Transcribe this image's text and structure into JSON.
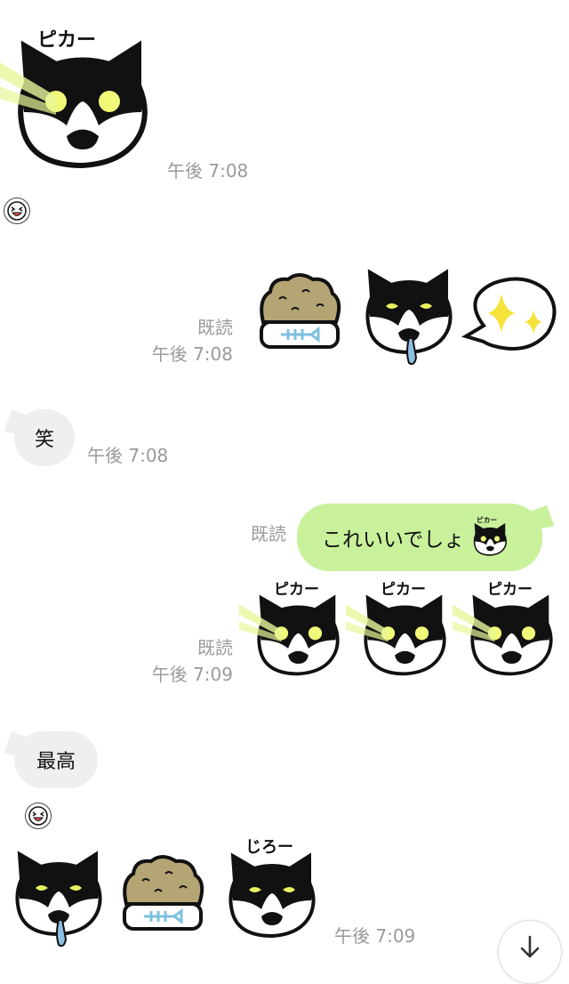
{
  "messages": [
    {
      "side": "in",
      "kind": "sticker",
      "sticker": "cat-pika",
      "sticker_text": "ピカー",
      "time": "午後 7:08"
    },
    {
      "side": "out",
      "kind": "emoji-set",
      "stickers": [
        "cat-food-bowl",
        "cat-drool",
        "sparkle-bubble"
      ],
      "read": "既読",
      "time": "午後 7:08"
    },
    {
      "side": "in",
      "kind": "text",
      "text": "笑",
      "time": "午後 7:08"
    },
    {
      "side": "out",
      "kind": "text",
      "text": "これいいでしょ",
      "inline_emoji_text": "ピカー",
      "read": "既読"
    },
    {
      "side": "out",
      "kind": "emoji-set",
      "stickers": [
        "cat-pika",
        "cat-pika",
        "cat-pika"
      ],
      "sticker_text": "ピカー",
      "read": "既読",
      "time": "午後 7:09"
    },
    {
      "side": "in",
      "kind": "text",
      "text": "最高"
    },
    {
      "side": "in",
      "kind": "emoji-set",
      "stickers": [
        "cat-drool",
        "cat-food-bowl",
        "cat-jiro"
      ],
      "sticker_text": "じろー",
      "time": "午後 7:09"
    }
  ],
  "scroll_button": {
    "icon": "arrow-down-icon"
  }
}
